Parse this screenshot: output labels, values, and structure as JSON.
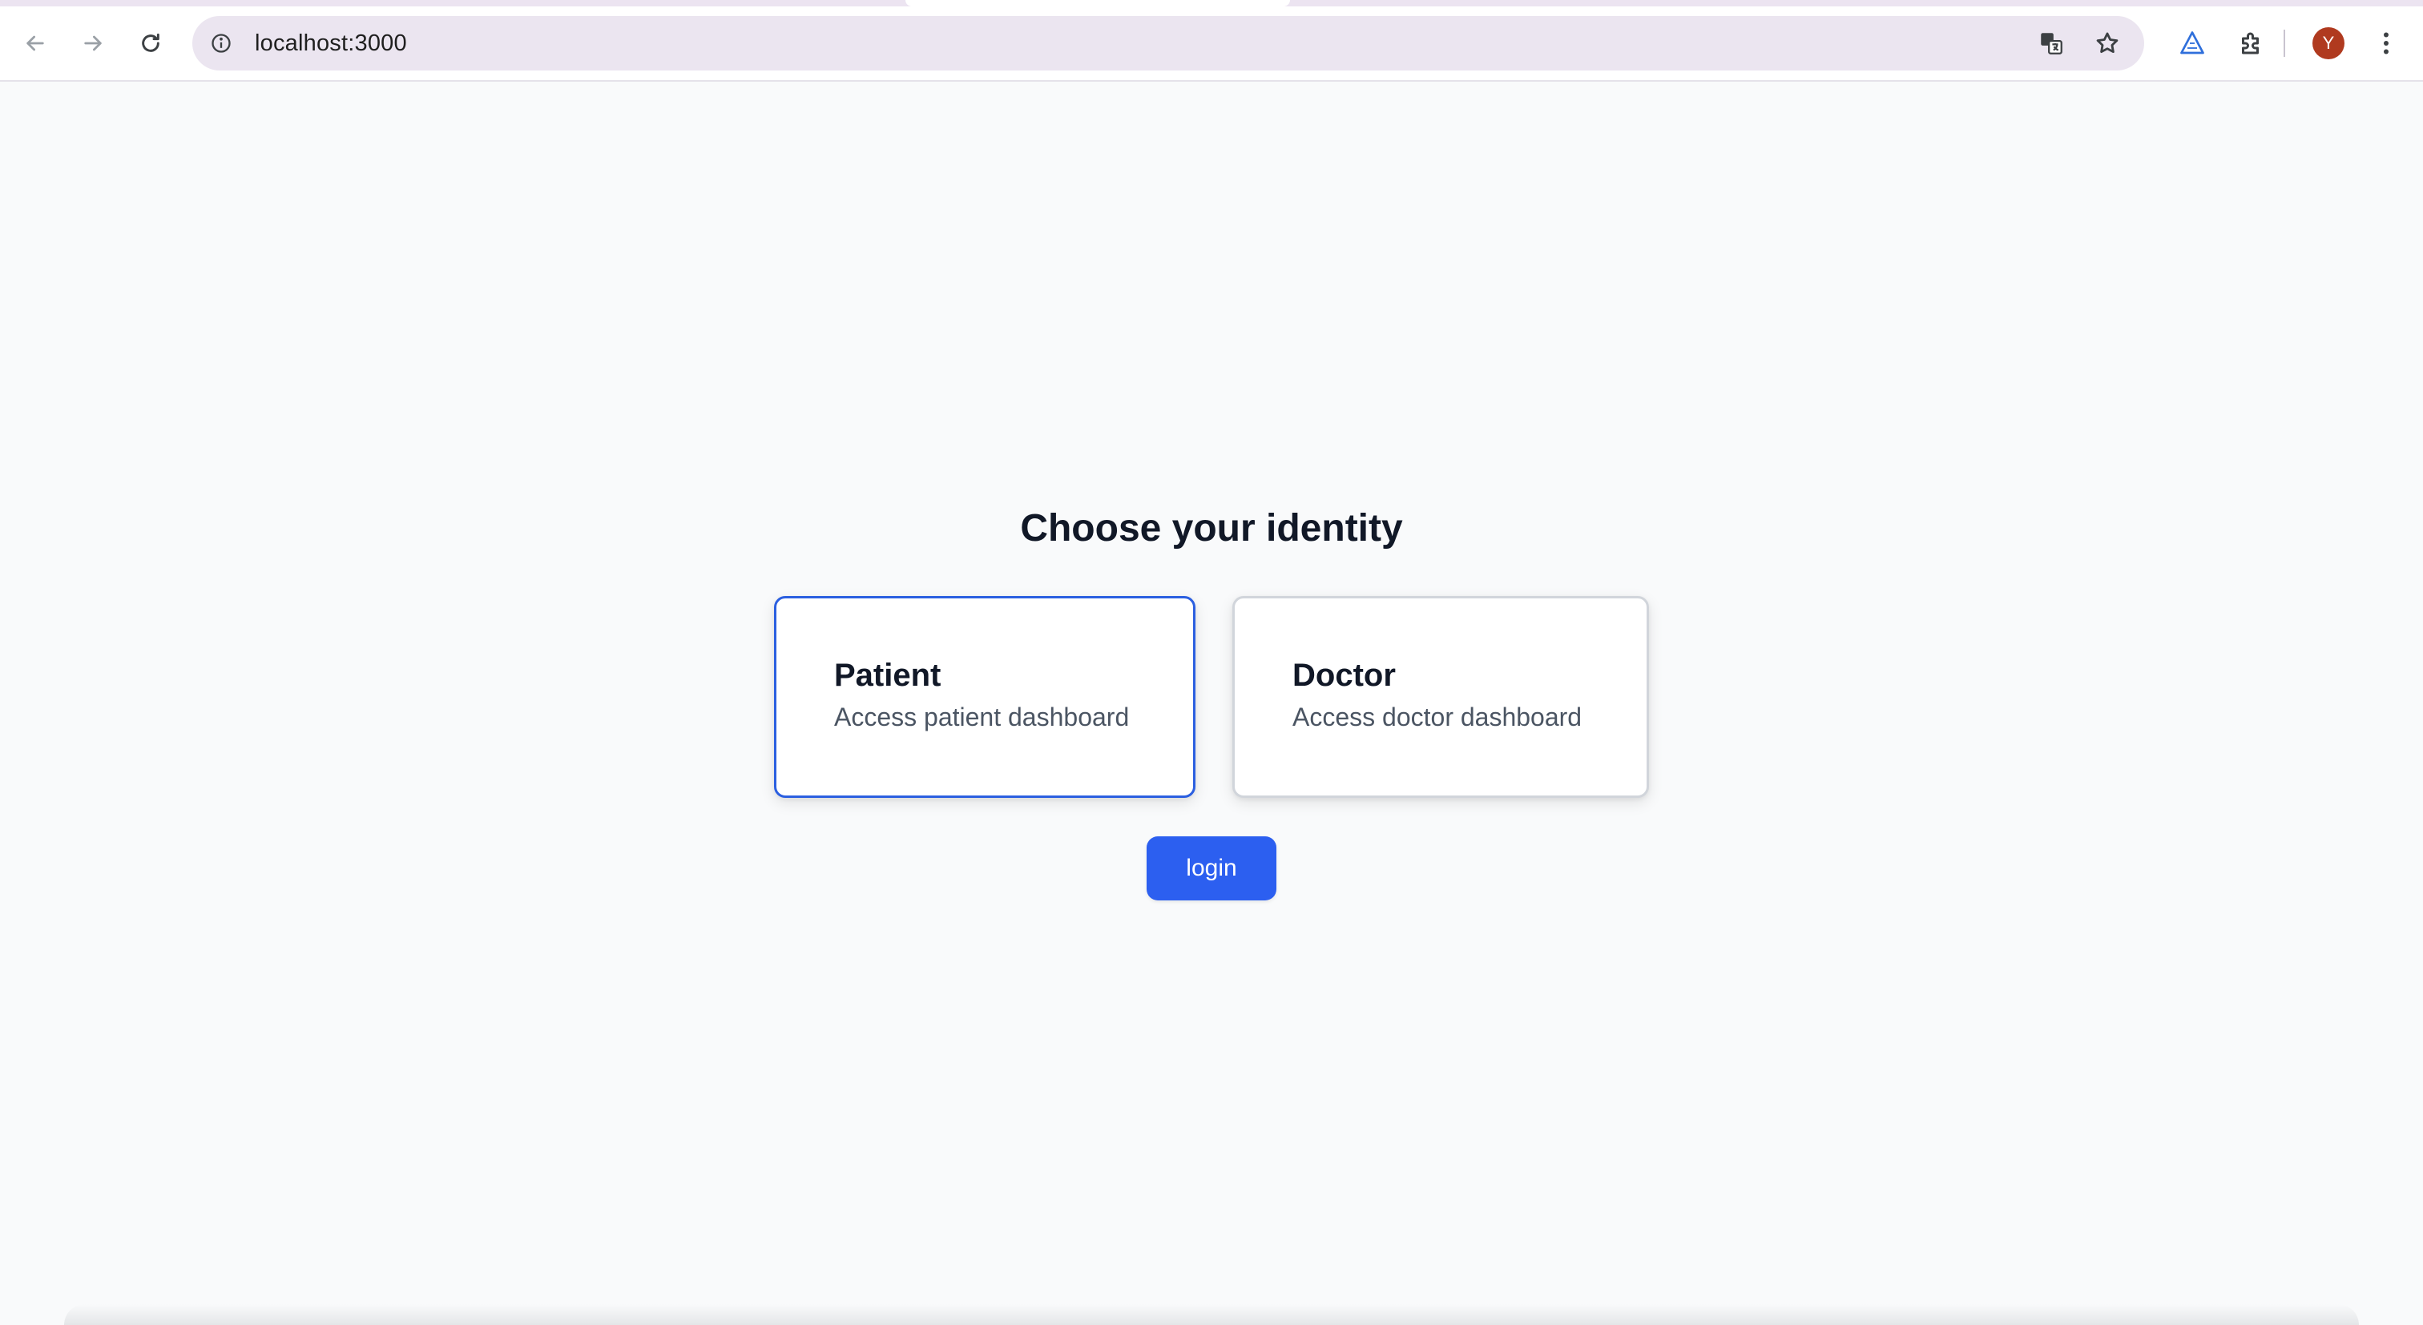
{
  "browser": {
    "url": "localhost:3000",
    "profile_initial": "Y",
    "colors": {
      "avatar": "#b03a1f",
      "omnibox": "#ebe5f0"
    },
    "icons": [
      "back-icon",
      "forward-icon",
      "reload-icon",
      "site-info-icon",
      "translate-icon",
      "bookmark-star-icon",
      "extension-triangle-icon",
      "extensions-puzzle-icon",
      "more-menu-icon"
    ]
  },
  "page": {
    "heading": "Choose your identity",
    "cards": [
      {
        "title": "Patient",
        "description": "Access patient dashboard",
        "selected": true
      },
      {
        "title": "Doctor",
        "description": "Access doctor dashboard",
        "selected": false
      }
    ],
    "login_label": "login",
    "colors": {
      "accent": "#2c5ff0",
      "selected_border": "#2b5fe0",
      "background": "#f9fafb"
    }
  }
}
